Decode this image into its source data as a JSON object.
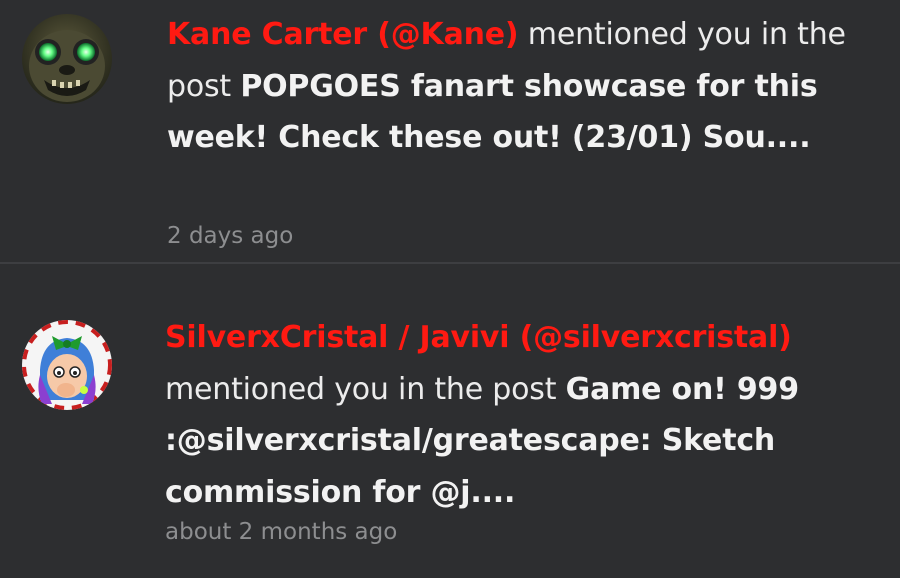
{
  "notifications": [
    {
      "user_display": "Kane Carter (@Kane)",
      "action_text": " mentioned you in the post ",
      "post_title": "POPGOES fanart showcase for this week! Check these out! (23/01) Sou....",
      "timestamp": "2 days ago",
      "avatar_icon": "animatronic-avatar-icon"
    },
    {
      "user_display": "SilverxCristal / Javivi (@silverxcristal)",
      "action_text": " mentioned you in the post ",
      "post_title": "Game on! 999 :@silverxcristal/greatescape: Sketch commission for @j....",
      "timestamp": "about 2 months ago",
      "avatar_icon": "cartoon-girl-avatar-icon"
    }
  ],
  "colors": {
    "background": "#2d2e30",
    "username": "#ff1a12",
    "timestamp": "#8d8e90",
    "divider": "#3d3e41"
  }
}
